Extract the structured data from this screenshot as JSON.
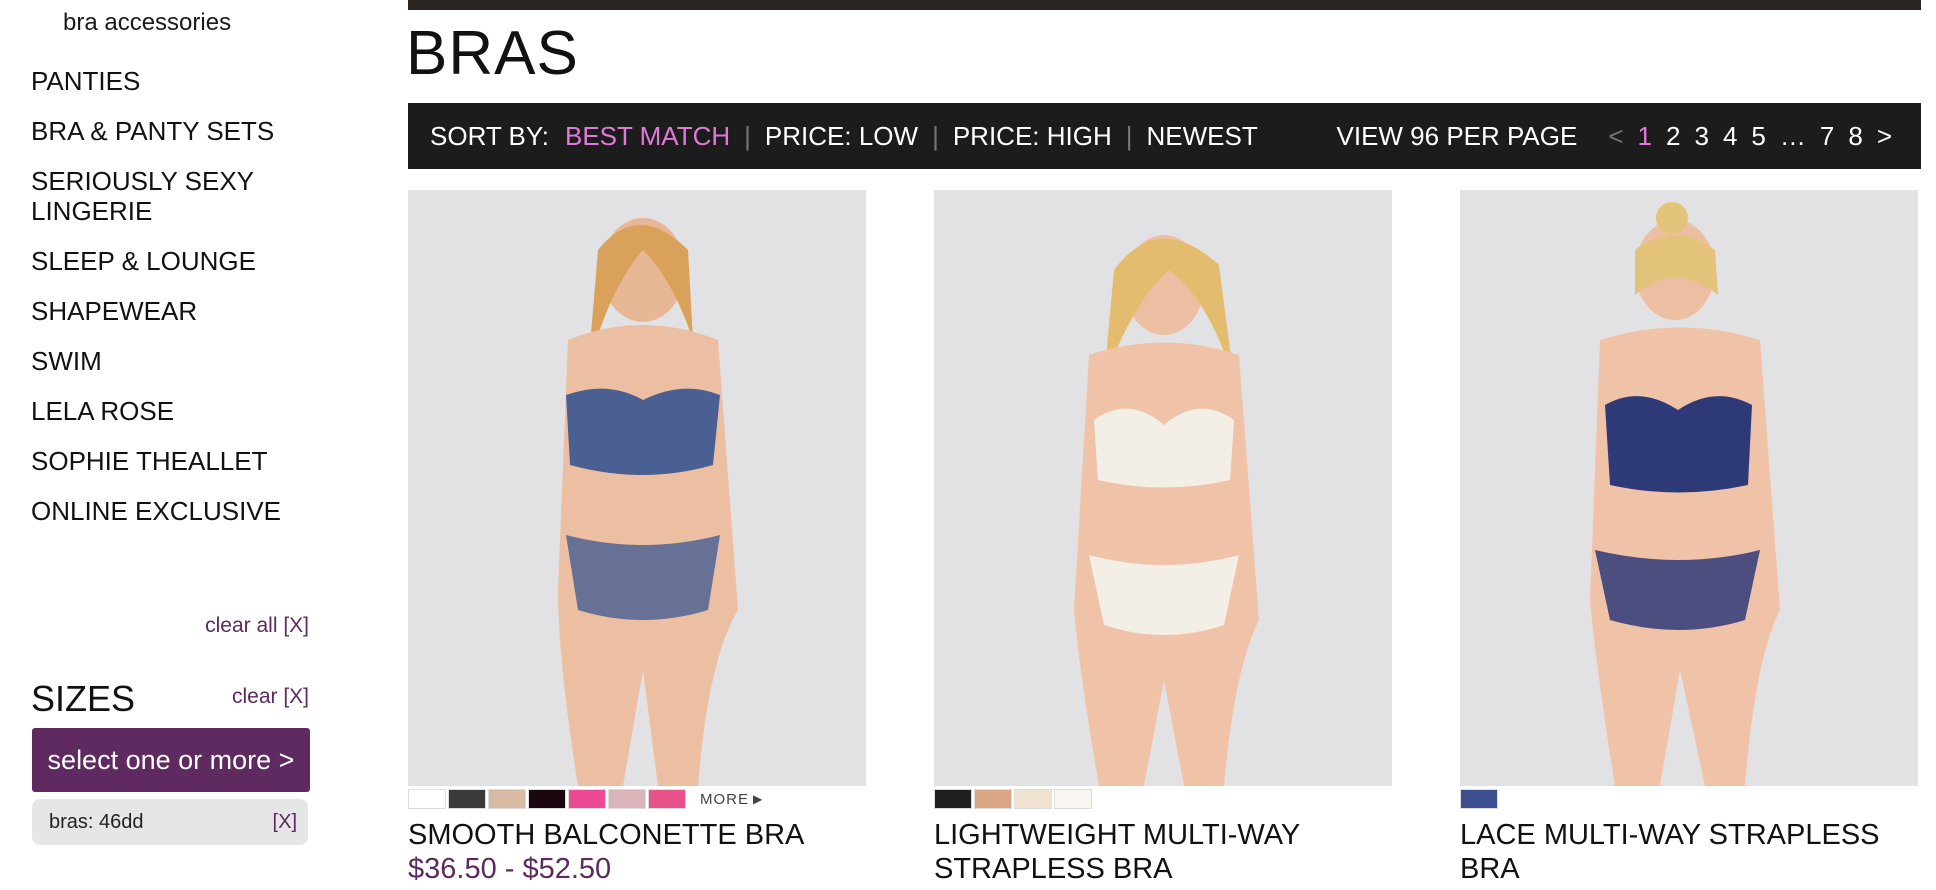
{
  "sidebar": {
    "sub_item": "bra accessories",
    "categories": [
      "PANTIES",
      "BRA & PANTY SETS",
      "SERIOUSLY SEXY LINGERIE",
      "SLEEP & LOUNGE",
      "SHAPEWEAR",
      "SWIM",
      "LELA ROSE",
      "SOPHIE THEALLET",
      "ONLINE EXCLUSIVE"
    ],
    "clear_all": "clear all [X]",
    "sizes_title": "SIZES",
    "sizes_clear": "clear [X]",
    "select_button": "select one or more >",
    "selected_chip": {
      "label": "bras: 46dd",
      "remove": "[X]"
    }
  },
  "main": {
    "title": "BRAS",
    "sort": {
      "label": "SORT BY:",
      "options": [
        "BEST MATCH",
        "PRICE: LOW",
        "PRICE: HIGH",
        "NEWEST"
      ],
      "active": "BEST MATCH",
      "view_per_page": "VIEW 96 PER PAGE"
    },
    "pager": {
      "prev": "<",
      "pages": [
        "1",
        "2",
        "3",
        "4",
        "5",
        "…",
        "7",
        "8"
      ],
      "current": "1",
      "next": ">"
    }
  },
  "products": [
    {
      "name": "SMOOTH BALCONETTE BRA",
      "price": "$36.50 - $52.50",
      "swatches": [
        "#ffffff",
        "#3a3a3a",
        "#d8b9a4",
        "#1a0710",
        "#ec4a94",
        "#d9b4b8",
        "#e7528a"
      ],
      "more": "MORE",
      "set_color": "#2f4f8f"
    },
    {
      "name": "LIGHTWEIGHT MULTI-WAY STRAPLESS BRA",
      "price": "",
      "swatches": [
        "#1f1f1f",
        "#d9a686",
        "#efe4d2",
        "#f8f6f1"
      ],
      "more": "",
      "set_color": "#f3efe6"
    },
    {
      "name": "LACE MULTI-WAY STRAPLESS BRA",
      "price": "",
      "swatches": [
        "#3c4f8f"
      ],
      "more": "",
      "set_color": "#2e3a78"
    }
  ]
}
